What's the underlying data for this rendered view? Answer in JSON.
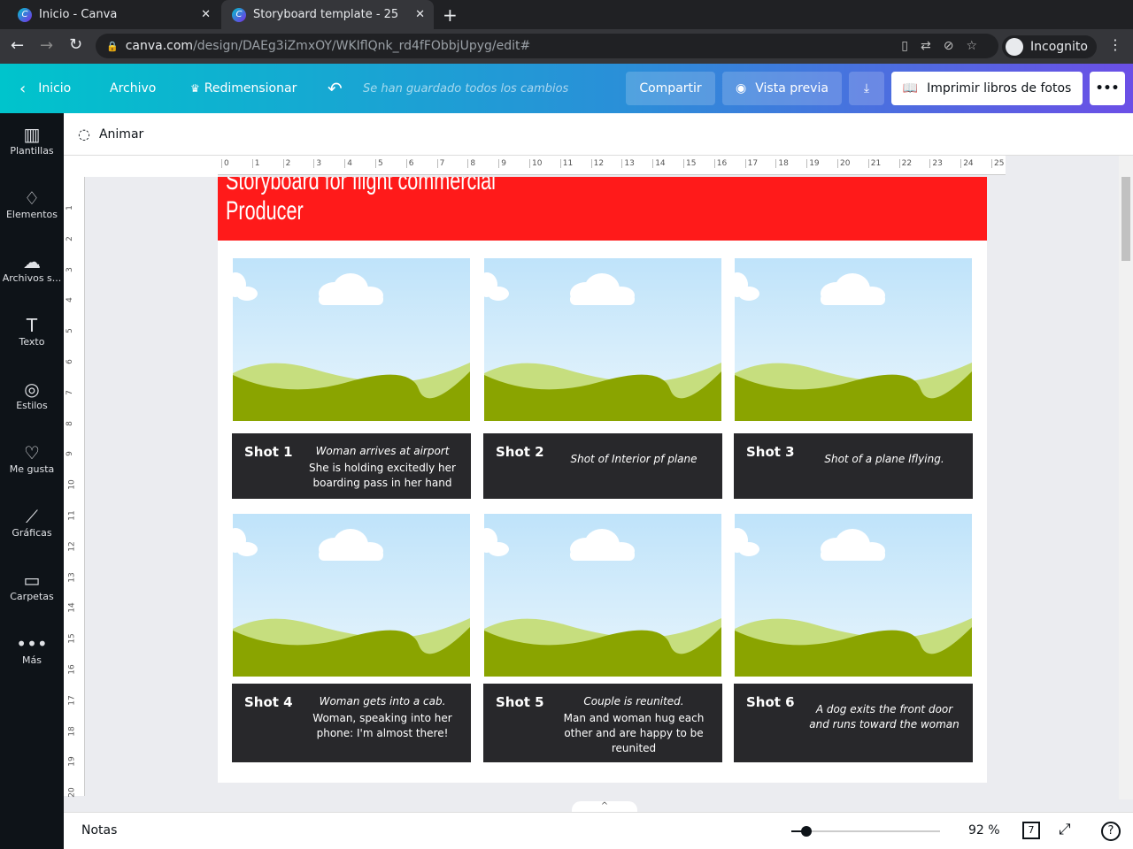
{
  "browser": {
    "tabs": [
      {
        "title": "Inicio - Canva"
      },
      {
        "title": "Storyboard template - 25"
      }
    ],
    "url_host": "canva.com",
    "url_path": "/design/DAEg3iZmxOY/WKIflQnk_rd4fFObbjUpyg/edit#",
    "incognito": "Incognito"
  },
  "header": {
    "home": "Inicio",
    "file": "Archivo",
    "resize": "Redimensionar",
    "saved": "Se han guardado todos los cambios",
    "share": "Compartir",
    "preview": "Vista previa",
    "print": "Imprimir libros de fotos"
  },
  "sidebar": {
    "items": [
      {
        "label": "Plantillas",
        "icon": "▥"
      },
      {
        "label": "Elementos",
        "icon": "♢"
      },
      {
        "label": "Archivos s...",
        "icon": "☁"
      },
      {
        "label": "Texto",
        "icon": "T"
      },
      {
        "label": "Estilos",
        "icon": "◎"
      },
      {
        "label": "Me gusta",
        "icon": "♡"
      },
      {
        "label": "Gráficas",
        "icon": "⟋"
      },
      {
        "label": "Carpetas",
        "icon": "▭"
      },
      {
        "label": "Más",
        "icon": "•••"
      }
    ]
  },
  "toolbar": {
    "animate": "Animar"
  },
  "ruler": {
    "top": [
      "0",
      "1",
      "2",
      "3",
      "4",
      "5",
      "6",
      "7",
      "8",
      "9",
      "10",
      "11",
      "12",
      "13",
      "14",
      "15",
      "16",
      "17",
      "18",
      "19",
      "20",
      "21",
      "22",
      "23",
      "24",
      "25"
    ],
    "left": [
      "1",
      "2",
      "3",
      "4",
      "5",
      "6",
      "7",
      "8",
      "9",
      "10",
      "11",
      "12",
      "13",
      "14",
      "15",
      "16",
      "17",
      "18",
      "19",
      "20"
    ]
  },
  "design": {
    "title_line1": "Storyboard for flight commercial",
    "title_line2": "Producer",
    "shots": [
      {
        "label": "Shot 1",
        "italic": "Woman arrives at airport",
        "text": "She is holding excitedly her boarding pass in her hand"
      },
      {
        "label": "Shot 2",
        "italic": "Shot of Interior pf plane",
        "text": ""
      },
      {
        "label": "Shot 3",
        "italic": "Shot of a plane lflying.",
        "text": ""
      },
      {
        "label": "Shot 4",
        "italic": "Woman gets into  a cab.",
        "text": "Woman, speaking into her phone: I'm almost there!"
      },
      {
        "label": "Shot 5",
        "italic": "Couple is reunited.",
        "text": "Man and woman hug each other and are happy to be reunited"
      },
      {
        "label": "Shot 6",
        "italic": "A dog exits the front door and runs toward the woman",
        "text": ""
      }
    ]
  },
  "bottom": {
    "notes": "Notas",
    "zoom": "92 %",
    "zoom_fraction": 0.1,
    "pages": "7",
    "help": "?"
  }
}
